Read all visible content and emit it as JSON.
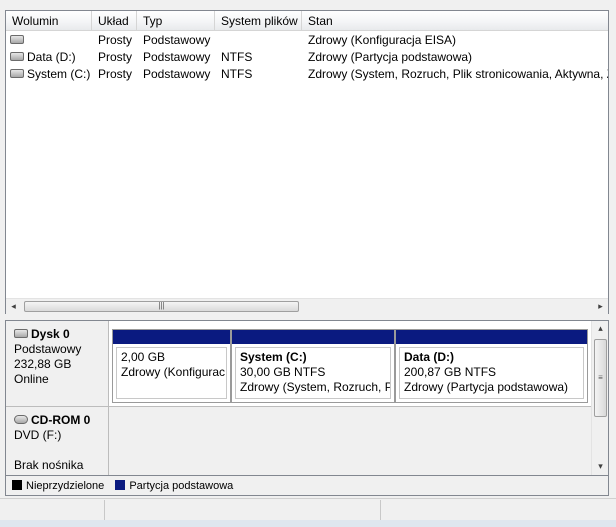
{
  "volume_list": {
    "columns": [
      "Wolumin",
      "Układ",
      "Typ",
      "System plików",
      "Stan"
    ],
    "rows": [
      {
        "volume": "",
        "layout": "Prosty",
        "type": "Podstawowy",
        "fs": "",
        "status": "Zdrowy (Konfiguracja EISA)"
      },
      {
        "volume": "Data (D:)",
        "layout": "Prosty",
        "type": "Podstawowy",
        "fs": "NTFS",
        "status": "Zdrowy (Partycja podstawowa)"
      },
      {
        "volume": "System (C:)",
        "layout": "Prosty",
        "type": "Podstawowy",
        "fs": "NTFS",
        "status": "Zdrowy (System, Rozruch, Plik stronicowania, Aktywna, Z"
      }
    ],
    "scroll_left": "◂",
    "scroll_right": "▸",
    "scroll_grip": "|||"
  },
  "disks": [
    {
      "name": "Dysk 0",
      "type": "Podstawowy",
      "size": "232,88 GB",
      "state": "Online",
      "icon": "disk-icon",
      "partitions": [
        {
          "title": "",
          "size": "2,00 GB",
          "status": "Zdrowy (Konfigurac"
        },
        {
          "title": "System  (C:)",
          "size": "30,00 GB NTFS",
          "status": "Zdrowy (System, Rozruch, P"
        },
        {
          "title": "Data  (D:)",
          "size": "200,87 GB NTFS",
          "status": "Zdrowy (Partycja podstawowa)"
        }
      ]
    },
    {
      "name": "CD-ROM 0",
      "type": "DVD (F:)",
      "state": "Brak nośnika",
      "icon": "cdrom-icon"
    }
  ],
  "disk_scroll": {
    "up": "▴",
    "down": "▾",
    "grip": "≡"
  },
  "legend": [
    {
      "label": "Nieprzydzielone",
      "color": "#000000"
    },
    {
      "label": "Partycja podstawowa",
      "color": "#0a1a80"
    }
  ],
  "colors": {
    "primary_partition": "#0a1a80"
  }
}
